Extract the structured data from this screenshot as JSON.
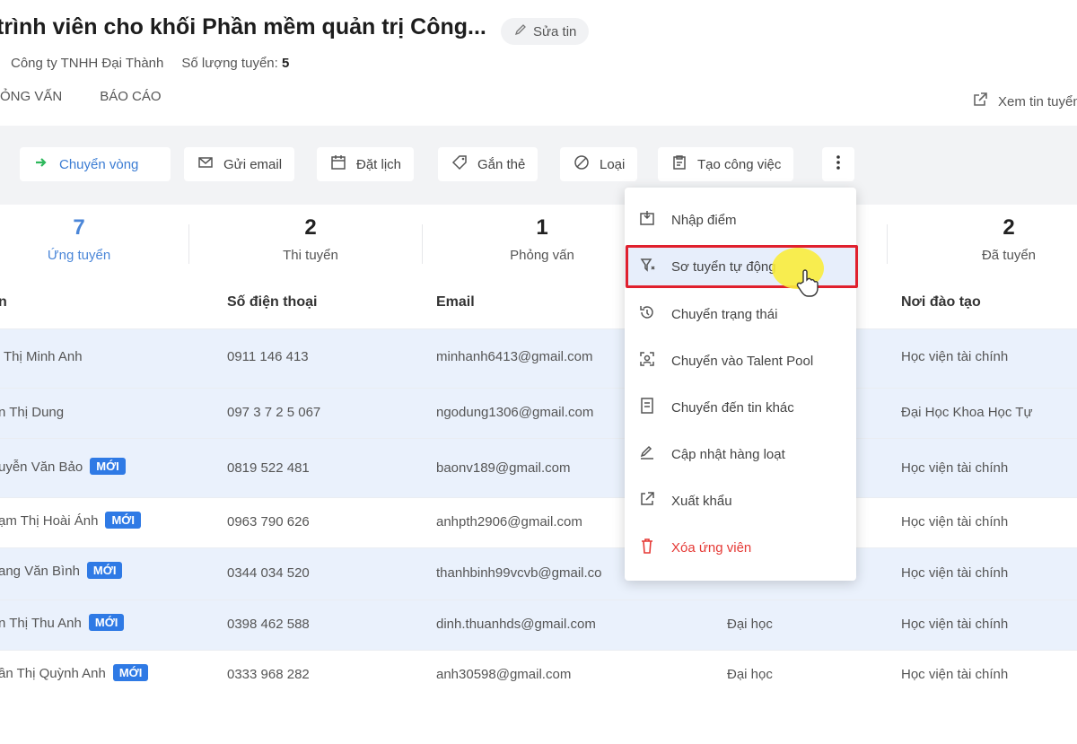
{
  "header": {
    "title": "trình viên cho khối Phần mềm quản trị Công...",
    "edit_label": "Sửa tin",
    "company": "Công ty TNHH Đại Thành",
    "quantity_label": "Số lượng tuyển:",
    "quantity_value": "5",
    "tabs": [
      "ỎNG VẤN",
      "BÁO CÁO"
    ],
    "view_post_label": "Xem tin tuyển"
  },
  "toolbar": {
    "move_label": "Chuyển vòng",
    "email_label": "Gửi email",
    "schedule_label": "Đặt lịch",
    "tag_label": "Gắn thẻ",
    "reject_label": "Loại",
    "task_label": "Tạo công việc"
  },
  "stages": [
    {
      "count": "7",
      "label": "Ứng tuyển",
      "active": true
    },
    {
      "count": "2",
      "label": "Thi tuyển"
    },
    {
      "count": "1",
      "label": "Phỏng vấn"
    },
    {
      "count": "2",
      "label": "Đã tuyển"
    }
  ],
  "table": {
    "headers": {
      "name": "n",
      "phone": "Số điện thoại",
      "email": "Email",
      "school": "Nơi đào tạo"
    },
    "badge_label": "MỚI",
    "rows": [
      {
        "name": "Thị Minh Anh",
        "phone": "0911 146 413",
        "email": "minhanh6413@gmail.com",
        "level": "",
        "school": "Học viện tài chính",
        "new": false
      },
      {
        "name": "n Thị Dung",
        "phone": "097 3 7 2 5 067",
        "email": "ngodung1306@gmail.com",
        "level": "",
        "school": "Đại Học Khoa Học Tự",
        "new": false
      },
      {
        "name": "uyễn Văn Bảo",
        "phone": "0819 522 481",
        "email": "baonv189@gmail.com",
        "level": "",
        "school": "Học viện tài chính",
        "new": true
      },
      {
        "name": "ạm Thị Hoài Ánh",
        "phone": "0963 790 626",
        "email": "anhpth2906@gmail.com",
        "level": "",
        "school": "Học viện tài chính",
        "new": true
      },
      {
        "name": "ang Văn Bình",
        "phone": "0344 034 520",
        "email": "thanhbinh99vcvb@gmail.co",
        "level": "",
        "school": "Học viện tài chính",
        "new": true
      },
      {
        "name": "n Thị Thu Anh",
        "phone": "0398 462 588",
        "email": "dinh.thuanhds@gmail.com",
        "level": "Đại học",
        "school": "Học viện tài chính",
        "new": true
      },
      {
        "name": "ần Thị Quỳnh Anh",
        "phone": "0333 968 282",
        "email": "anh30598@gmail.com",
        "level": "Đại học",
        "school": "Học viện tài chính",
        "new": true
      }
    ]
  },
  "menu": {
    "items": [
      {
        "label": "Nhập điểm",
        "icon": "import-score-icon"
      },
      {
        "label": "Sơ tuyển tự động",
        "icon": "auto-screen-icon",
        "highlighted": true
      },
      {
        "label": "Chuyển trạng thái",
        "icon": "status-change-icon"
      },
      {
        "label": "Chuyển vào Talent Pool",
        "icon": "talent-pool-icon"
      },
      {
        "label": "Chuyển đến tin khác",
        "icon": "move-post-icon"
      },
      {
        "label": "Cập nhật hàng loạt",
        "icon": "bulk-edit-icon"
      },
      {
        "label": "Xuất khẩu",
        "icon": "export-icon"
      },
      {
        "label": "Xóa ứng viên",
        "icon": "trash-icon",
        "danger": true
      }
    ]
  },
  "colors": {
    "accent": "#3b7cd3",
    "badge": "#2f7ae5",
    "danger": "#e53935",
    "highlight_border": "#e0202d"
  }
}
